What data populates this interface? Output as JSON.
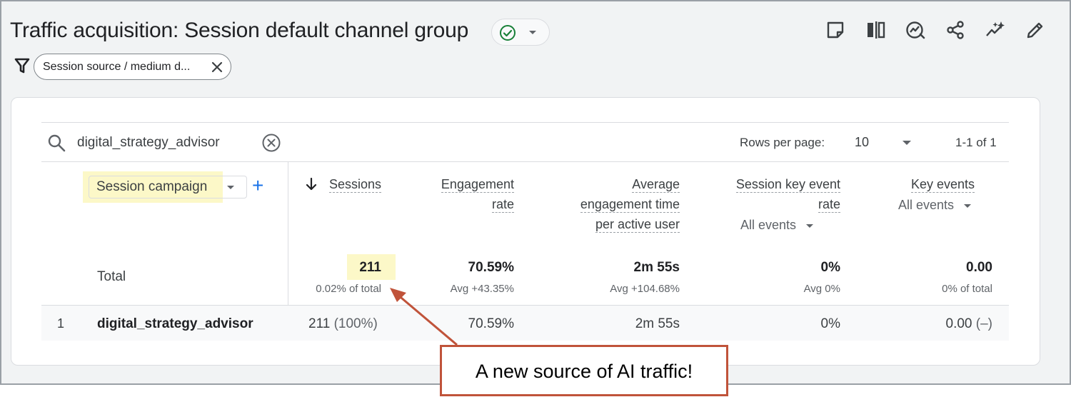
{
  "header": {
    "title": "Traffic acquisition: Session default channel group",
    "status_color": "#188038",
    "toolbar_icons": [
      "note-icon",
      "compare-icon",
      "insights-icon",
      "share-icon",
      "sparkle-trend-icon",
      "edit-icon"
    ]
  },
  "filter": {
    "chip_label": "Session source / medium d..."
  },
  "table": {
    "search_value": "digital_strategy_advisor",
    "rows_per_page_label": "Rows per page:",
    "rows_per_page_value": "10",
    "pagination": "1-1 of 1",
    "dimension": "Session campaign",
    "columns": {
      "sessions": "Sessions",
      "engagement_line1": "Engagement",
      "engagement_line2": "rate",
      "avg_line1": "Average",
      "avg_line2": "engagement time",
      "avg_line3": "per active user",
      "ske_line1": "Session key event",
      "ske_line2": "rate",
      "ske_sub": "All events",
      "key_events": "Key events",
      "key_events_sub": "All events"
    },
    "totals": {
      "label": "Total",
      "sessions": "211",
      "sessions_sub": "0.02% of total",
      "engagement": "70.59%",
      "engagement_sub": "Avg +43.35%",
      "avg_time": "2m 55s",
      "avg_time_sub": "Avg +104.68%",
      "ske": "0%",
      "ske_sub": "Avg 0%",
      "key_events": "0.00",
      "key_events_sub": "0% of total"
    },
    "rows": [
      {
        "num": "1",
        "name": "digital_strategy_advisor",
        "sessions": "211",
        "sessions_pct": "(100%)",
        "engagement": "70.59%",
        "avg_time": "2m 55s",
        "ske": "0%",
        "key_events": "0.00",
        "key_events_pct": "(–)"
      }
    ]
  },
  "annotation": {
    "text": "A new source of AI traffic!",
    "color": "#c0533a",
    "highlight_color": "#fcf8c8"
  }
}
